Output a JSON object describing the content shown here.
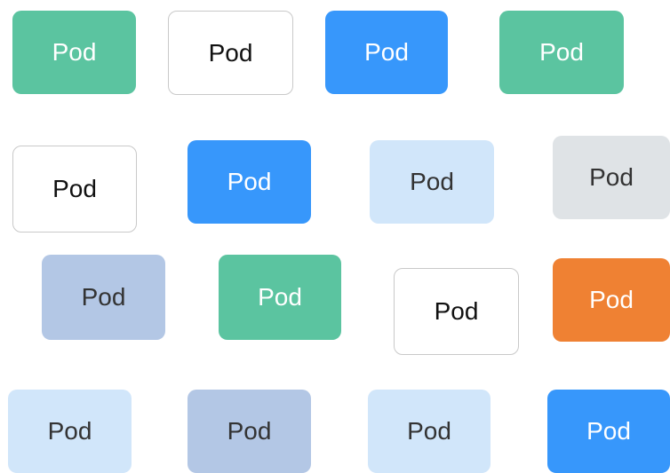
{
  "pods": [
    {
      "label": "Pod",
      "style": "green"
    },
    {
      "label": "Pod",
      "style": "white"
    },
    {
      "label": "Pod",
      "style": "blue"
    },
    {
      "label": "Pod",
      "style": "green"
    },
    {
      "label": "Pod",
      "style": "white"
    },
    {
      "label": "Pod",
      "style": "blue"
    },
    {
      "label": "Pod",
      "style": "lightblue"
    },
    {
      "label": "Pod",
      "style": "gray"
    },
    {
      "label": "Pod",
      "style": "slate"
    },
    {
      "label": "Pod",
      "style": "green"
    },
    {
      "label": "Pod",
      "style": "white"
    },
    {
      "label": "Pod",
      "style": "orange"
    },
    {
      "label": "Pod",
      "style": "lightblue"
    },
    {
      "label": "Pod",
      "style": "slate"
    },
    {
      "label": "Pod",
      "style": "lightblue"
    },
    {
      "label": "Pod",
      "style": "blue"
    }
  ],
  "colors": {
    "green": {
      "bg": "#5bc4a0",
      "fg": "#ffffff",
      "outlined": false
    },
    "white": {
      "bg": "#ffffff",
      "fg": "#111111",
      "outlined": true
    },
    "blue": {
      "bg": "#3797fb",
      "fg": "#ffffff",
      "outlined": false
    },
    "lightblue": {
      "bg": "#d1e6fa",
      "fg": "#333333",
      "outlined": false
    },
    "gray": {
      "bg": "#dfe3e6",
      "fg": "#333333",
      "outlined": false
    },
    "slate": {
      "bg": "#b3c7e5",
      "fg": "#333333",
      "outlined": false
    },
    "orange": {
      "bg": "#ef8133",
      "fg": "#ffffff",
      "outlined": false
    }
  }
}
